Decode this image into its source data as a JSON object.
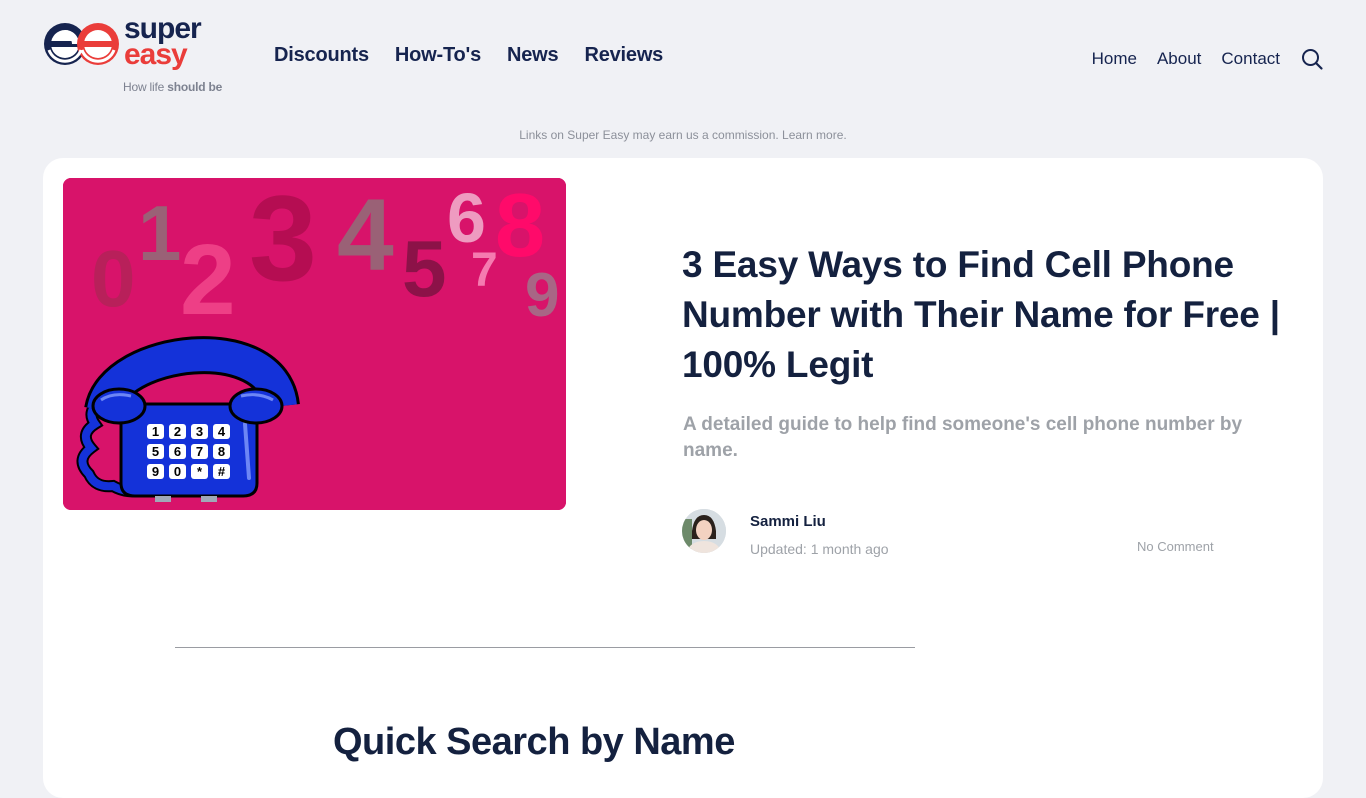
{
  "brand": {
    "word1": "super",
    "word2": "easy",
    "tagline_prefix": "How life ",
    "tagline_bold": "should be",
    "colors": {
      "navy": "#16244f",
      "red": "#ea3d3a"
    }
  },
  "main_nav": [
    {
      "label": "Discounts"
    },
    {
      "label": "How-To's"
    },
    {
      "label": "News"
    },
    {
      "label": "Reviews"
    }
  ],
  "secondary_nav": [
    {
      "label": "Home"
    },
    {
      "label": "About"
    },
    {
      "label": "Contact"
    }
  ],
  "search": {
    "icon": "search-icon"
  },
  "disclaimer": "Links on Super Easy may earn us a commission. Learn more.",
  "article": {
    "hero_image": {
      "description": "Telephone illustration with floating digits",
      "background": "#d8136a",
      "digits": [
        "0",
        "1",
        "2",
        "3",
        "4",
        "5",
        "6",
        "7",
        "8",
        "9"
      ],
      "keypad": [
        "1",
        "2",
        "3",
        "4",
        "5",
        "6",
        "7",
        "8",
        "9",
        "0",
        "*",
        "#"
      ]
    },
    "title": "3 Easy Ways to Find Cell Phone Number with Their Name for Free | 100% Legit",
    "subtitle": "A detailed guide to help find someone's cell phone number by name.",
    "author": {
      "name": "Sammi Liu",
      "updated": "Updated: 1 month ago"
    },
    "comments": "No Comment"
  },
  "section": {
    "title": "Quick Search by Name"
  }
}
